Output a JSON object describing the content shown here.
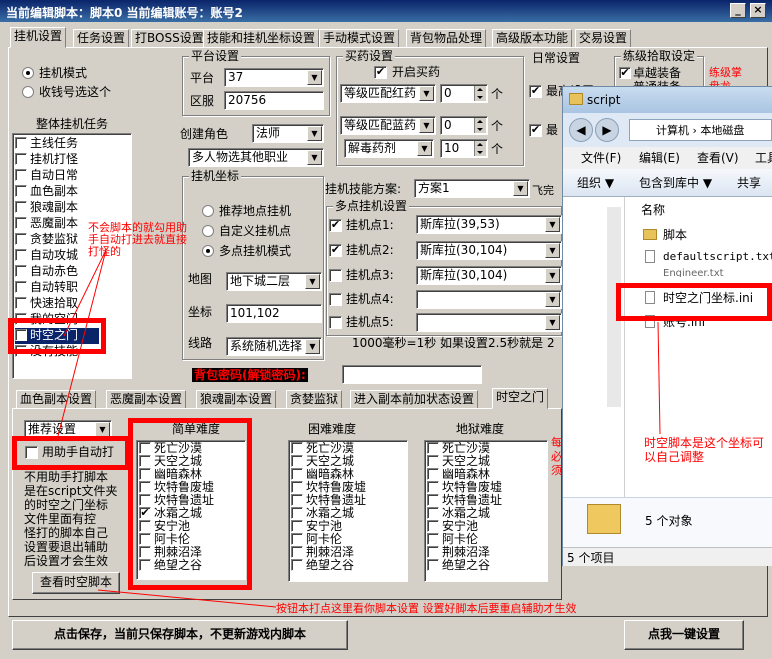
{
  "window": {
    "title": "当前编辑脚本：脚本0     当前编辑账号：账号2",
    "minimize": "_",
    "close": "×"
  },
  "tabs": [
    "挂机设置",
    "任务设置",
    "打BOSS设置",
    "技能和挂机坐标设置",
    "手动模式设置",
    "背包物品处理",
    "高级版本功能",
    "交易设置"
  ],
  "mode": {
    "option1": "挂机模式",
    "option2": "收钱号选这个"
  },
  "tasks": {
    "title": "整体挂机任务",
    "items": [
      "主线任务",
      "挂机打怪",
      "自动日常",
      "血色副本",
      "狼魂副本",
      "恶魔副本",
      "贪婪监狱",
      "自动攻城",
      "自动赤色",
      "自动转职",
      "快速拾取",
      "我的空门",
      "时空之门",
      "没有技能"
    ],
    "selected": "时空之门"
  },
  "platform": {
    "title": "平台设置",
    "platform_label": "平台",
    "platform_value": "37",
    "server_label": "区服",
    "server_value": "20756"
  },
  "create_role": {
    "label": "创建角色",
    "class_value": "法师",
    "server_choice": "多人物选其他职业"
  },
  "buy_drugs": {
    "title": "买药设置",
    "enable": "开启买药",
    "red_drug": "等级匹配红药",
    "red_qty": "0",
    "blue_drug": "等级匹配蓝药",
    "blue_qty": "0",
    "antidote": "解毒药剂",
    "antidote_qty": "10",
    "unit": "个"
  },
  "daily": {
    "title": "日常设置",
    "item1": "最高设置",
    "item2": "最"
  },
  "practice": {
    "title": "练级拾取设定",
    "item1": "卓越装备",
    "item2": "普通装备",
    "note": "练级掌盘龙"
  },
  "coords": {
    "title": "挂机坐标",
    "opt1": "推荐地点挂机",
    "opt2": "自定义挂机点",
    "opt3": "多点挂机模式",
    "map_label": "地图",
    "map_value": "地下城二层",
    "coord_label": "坐标",
    "coord_value": "101,102",
    "route_label": "线路",
    "route_value": "系统随机选择"
  },
  "skill_scheme": {
    "label": "挂机技能方案:",
    "value": "方案1",
    "suffix": "飞完"
  },
  "multipoint": {
    "title": "多点挂机设置",
    "points": [
      {
        "label": "挂机点1:",
        "value": "斯库拉(39,53)",
        "checked": true
      },
      {
        "label": "挂机点2:",
        "value": "斯库拉(30,104)",
        "checked": true
      },
      {
        "label": "挂机点3:",
        "value": "斯库拉(30,104)",
        "checked": false
      },
      {
        "label": "挂机点4:",
        "value": "",
        "checked": false
      },
      {
        "label": "挂机点5:",
        "value": "",
        "checked": false
      }
    ],
    "note": "1000毫秒=1秒  如果设置2.5秒就是 2"
  },
  "bag_password": {
    "label": "背包密码(解锁密码):",
    "value": ""
  },
  "subtabs": [
    "血色副本设置",
    "恶魔副本设置",
    "狼魂副本设置",
    "贪婪监狱",
    "进入副本前加状态设置",
    "时空之门"
  ],
  "gate": {
    "combo": "推荐设置",
    "assist": "用助手自动打",
    "desc": [
      "不用助手打脚本",
      "是在script文件夹",
      "的时空之门坐标",
      "文件里面有控",
      "怪打的脚本自己",
      "设置要退出辅助",
      "后设置才会生效"
    ],
    "view_button": "查看时空脚本",
    "col_easy": "简单难度",
    "col_hard": "困难难度",
    "col_hell": "地狱难度",
    "maps": [
      "死亡沙漠",
      "天空之城",
      "幽暗森林",
      "坎特鲁废墟",
      "坎特鲁遗址",
      "冰霜之城",
      "安宁池",
      "阿卡伦",
      "荆棘沼泽",
      "绝望之谷"
    ],
    "easy_checked": "冰霜之城",
    "side_note": "每必须"
  },
  "annotations": {
    "note1": "不会脚本的就勾用助手自动打进去就直接打怪的",
    "note2": "时空脚本是这个坐标可以自己调整",
    "note3": "按钮本打点这里看你脚本设置 设置好脚本后要重启辅助才生效"
  },
  "footer": {
    "save": "点击保存，当前只保存脚本，不更新游戏内脚本",
    "one_key": "点我一键设置"
  },
  "explorer": {
    "title": "script",
    "breadcrumb": "计算机 › 本地磁盘",
    "menu": [
      "文件(F)",
      "编辑(E)",
      "查看(V)",
      "工具"
    ],
    "toolbar": [
      "组织 ▼",
      "包含到库中 ▼",
      "共享"
    ],
    "col_name": "名称",
    "files": [
      "脚本",
      "defaultscript.txt",
      "Engineer.txt",
      "时空之门坐标.ini",
      "账号.ini"
    ],
    "count": "5 个对象",
    "status": "5 个项目"
  },
  "colors": {
    "title_start": "#0a246a",
    "title_end": "#3a6ea5",
    "face": "#d4d0c8",
    "annotation": "#ff0000",
    "selection": "#0a246a"
  }
}
